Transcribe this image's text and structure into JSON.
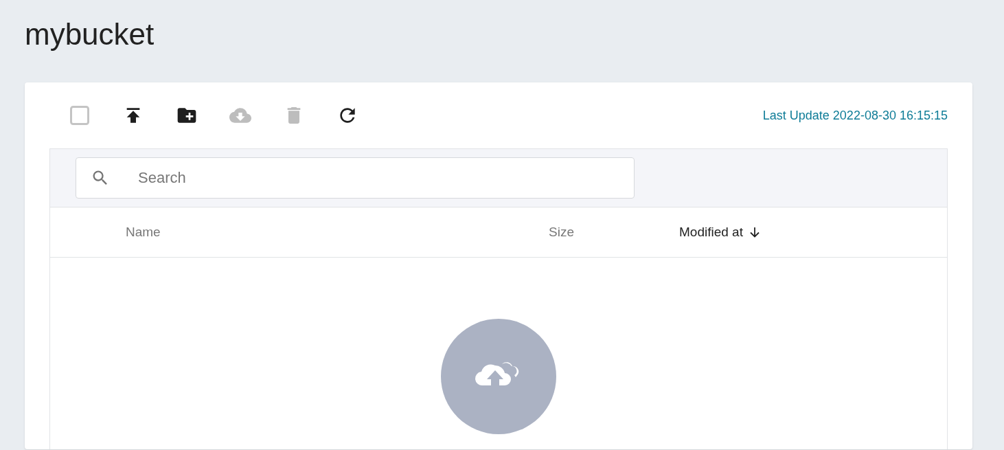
{
  "title": "mybucket",
  "toolbar": [
    {
      "kind": "select-all",
      "checked": false
    },
    {
      "kind": "upload",
      "disabled": false
    },
    {
      "kind": "new-folder",
      "disabled": false
    },
    {
      "kind": "download",
      "disabled": true
    },
    {
      "kind": "delete",
      "disabled": true
    },
    {
      "kind": "refresh",
      "disabled": false
    }
  ],
  "last_update": "Last Update 2022-08-30 16:15:15",
  "search": {
    "placeholder": "Search"
  },
  "columns": [
    {
      "label": "Name",
      "sorted": false
    },
    {
      "label": "Size",
      "sorted": false
    },
    {
      "label": "Modified at",
      "sorted": true
    }
  ],
  "empty_state": {
    "kind": "upload"
  }
}
